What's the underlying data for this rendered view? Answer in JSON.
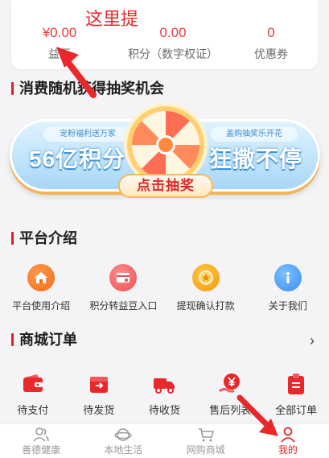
{
  "annotation": {
    "text": "这里提",
    "color": "#e8282b"
  },
  "stats": [
    {
      "value": "¥0.00",
      "label": "益豆"
    },
    {
      "value": "0.00",
      "label": "积分（数字权证）"
    },
    {
      "value": "0",
      "label": "优惠券"
    }
  ],
  "lottery": {
    "title": "消费随机获得抽奖机会",
    "tag_left": "宠粉福利送万家",
    "tag_right": "盖购抽奖乐开花",
    "big_left": "56亿积分",
    "big_right": "狂撒不停",
    "button": "点击抽奖"
  },
  "platform": {
    "title": "平台介绍",
    "items": [
      {
        "label": "平台使用介绍",
        "icon": "home-icon"
      },
      {
        "label": "积分转益豆入口",
        "icon": "transfer-card-icon"
      },
      {
        "label": "提现确认打款",
        "icon": "coin-star-icon"
      },
      {
        "label": "关于我们",
        "icon": "info-icon"
      }
    ]
  },
  "orders": {
    "title": "商城订单",
    "chevron": "›",
    "items": [
      {
        "label": "待支付",
        "icon": "wallet-icon"
      },
      {
        "label": "待发货",
        "icon": "box-icon"
      },
      {
        "label": "待收货",
        "icon": "truck-icon"
      },
      {
        "label": "售后列表",
        "icon": "yen-service-icon"
      },
      {
        "label": "全部订单",
        "icon": "clipboard-icon"
      }
    ]
  },
  "tabbar": [
    {
      "label": "善德健康",
      "icon": "users-icon",
      "active": false
    },
    {
      "label": "本地生活",
      "icon": "planet-icon",
      "active": false
    },
    {
      "label": "网购商城",
      "icon": "cart-icon",
      "active": false
    },
    {
      "label": "我的",
      "icon": "person-icon",
      "active": true
    }
  ],
  "colors": {
    "accent": "#e8282b",
    "inactive": "#9a9a9a",
    "background": "#f4f4f6"
  }
}
